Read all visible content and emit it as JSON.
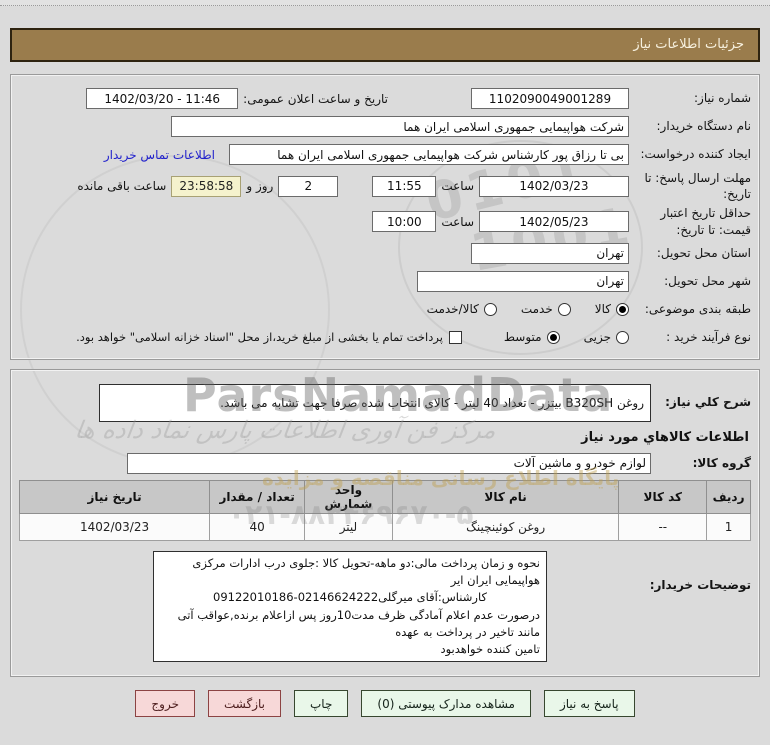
{
  "header": {
    "title": "جزئیات اطلاعات نیاز"
  },
  "fields": {
    "need_number": {
      "label": "شماره نیاز:",
      "value": "1102090049001289"
    },
    "announce": {
      "label": "تاریخ و ساعت اعلان عمومی:",
      "value": "1402/03/20 - 11:46"
    },
    "buyer_org": {
      "label": "نام دستگاه خریدار:",
      "value": "شرکت هواپیمایی جمهوری اسلامی ایران هما"
    },
    "creator": {
      "label": "ایجاد کننده درخواست:",
      "value": "بی تا رزاق پور کارشناس شرکت هواپیمایی جمهوری اسلامی ایران هما",
      "link": "اطلاعات تماس خریدار"
    },
    "deadline": {
      "label": "مهلت ارسال پاسخ: تا تاریخ:",
      "date": "1402/03/23",
      "hour_label": "ساعت",
      "time": "11:55",
      "days": "2",
      "days_label": "روز و",
      "countdown": "23:58:58",
      "remain_label": "ساعت باقی مانده"
    },
    "validity": {
      "label": "حداقل تاریخ اعتبار قیمت: تا تاریخ:",
      "date": "1402/05/23",
      "hour_label": "ساعت",
      "time": "10:00"
    },
    "province": {
      "label": "استان محل تحویل:",
      "value": "تهران"
    },
    "city": {
      "label": "شهر محل تحویل:",
      "value": "تهران"
    },
    "classification": {
      "label": "طبقه بندی موضوعی:",
      "options": [
        {
          "label": "کالا",
          "selected": true
        },
        {
          "label": "خدمت",
          "selected": false
        },
        {
          "label": "کالا/خدمت",
          "selected": false
        }
      ]
    },
    "process": {
      "label": "نوع فرآیند خرید :",
      "options": [
        {
          "label": "جزیی",
          "selected": false
        },
        {
          "label": "متوسط",
          "selected": true
        }
      ],
      "checkbox_label": "پرداخت تمام یا بخشی از مبلغ خرید،از محل \"اسناد خزانه اسلامی\" خواهد بود.",
      "checkbox_checked": false
    }
  },
  "need_desc": {
    "label": "شرح کلي نیاز:",
    "value": "روغن B320SH بیتزر - تعداد 40 لیتر - کالای انتخاب شده صرفا جهت تشابه می باشد."
  },
  "goods_section": {
    "heading": "اطلاعات کالاهاي مورد نیاز",
    "group_label": "گروه کالا:",
    "group_value": "لوازم خودرو و ماشین آلات"
  },
  "table": {
    "headers": [
      "ردیف",
      "کد کالا",
      "نام کالا",
      "واحد شمارش",
      "تعداد / مقدار",
      "تاریخ نیاز"
    ],
    "rows": [
      [
        "1",
        "--",
        "روغن کوئینچینگ",
        "لیتر",
        "40",
        "1402/03/23"
      ]
    ]
  },
  "buyer_notes": {
    "label": "توضیحات خریدار:",
    "lines": [
      "نحوه و زمان پرداخت مالی:دو ماهه-تحویل کالا :جلوی درب ادارات مرکزی هواپیمایی ایران ایر",
      "کارشناس:آقای میرگلی02146624222-09122010186",
      "درصورت عدم اعلام آمادگی ظرف مدت10روز پس ازاعلام برنده,عواقب آتی مانند تاخیر در پرداخت به عهده",
      "تامین کننده خواهدبود"
    ]
  },
  "buttons": {
    "respond": "پاسخ به نیاز",
    "attachments": "مشاهده مدارک پیوستی (0)",
    "print": "چاپ",
    "back": "بازگشت",
    "exit": "خروج"
  },
  "watermarks": {
    "brand": "ParsNamadData",
    "calligraphy": "مرکز فن آوری اطلاعات پارس نماد داده ها",
    "fa_line": "پایگاه اطلاع رسانی مناقصه و مزایده",
    "phone": "۰۲۱-۸۸۳۴۶۹۶۷۰-۵",
    "stamp_digits_1": "0101",
    "stamp_digits_2": "1001"
  }
}
